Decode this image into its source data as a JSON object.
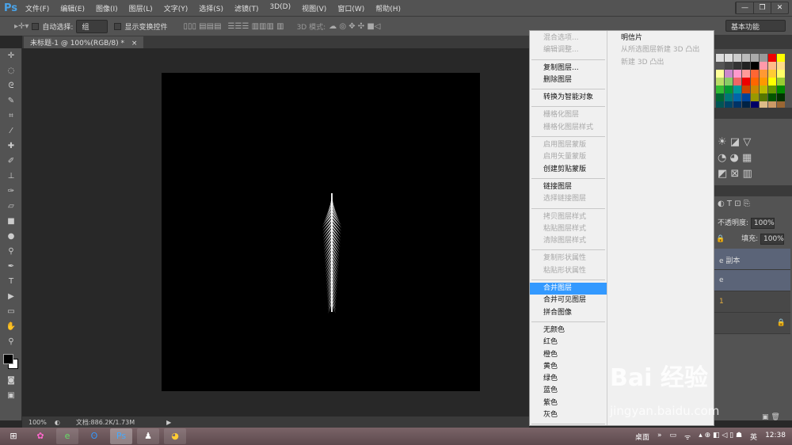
{
  "app": {
    "logo": "Ps",
    "menus": [
      "文件(F)",
      "编辑(E)",
      "图像(I)",
      "图层(L)",
      "文字(Y)",
      "选择(S)",
      "滤镜(T)",
      "3D(D)",
      "视图(V)",
      "窗口(W)",
      "帮助(H)"
    ],
    "window_controls": [
      "—",
      "❐",
      "✕"
    ]
  },
  "options": {
    "auto_select_label": "自动选择:",
    "auto_select_value": "组",
    "show_transform_label": "显示变换控件",
    "mode_3d_label": "3D 模式:",
    "workspace": "基本功能"
  },
  "document": {
    "tab_title": "未标题-1 @ 100%(RGB/8) *",
    "tab_close": "×"
  },
  "status": {
    "zoom": "100%",
    "doc_size": "文档:886.2K/1.73M"
  },
  "context_menu": {
    "left_groups": [
      [
        {
          "label": "混合选项...",
          "enabled": false
        },
        {
          "label": "编辑调整...",
          "enabled": false
        }
      ],
      [
        {
          "label": "复制图层...",
          "enabled": true
        },
        {
          "label": "删除图层",
          "enabled": true
        }
      ],
      [
        {
          "label": "转换为智能对象",
          "enabled": true
        }
      ],
      [
        {
          "label": "栅格化图层",
          "enabled": false
        },
        {
          "label": "栅格化图层样式",
          "enabled": false
        }
      ],
      [
        {
          "label": "启用图层蒙版",
          "enabled": false
        },
        {
          "label": "启用矢量蒙版",
          "enabled": false
        },
        {
          "label": "创建剪贴蒙版",
          "enabled": true
        }
      ],
      [
        {
          "label": "链接图层",
          "enabled": true
        },
        {
          "label": "选择链接图层",
          "enabled": false
        }
      ],
      [
        {
          "label": "拷贝图层样式",
          "enabled": false
        },
        {
          "label": "粘贴图层样式",
          "enabled": false
        },
        {
          "label": "清除图层样式",
          "enabled": false
        }
      ],
      [
        {
          "label": "复制形状属性",
          "enabled": false
        },
        {
          "label": "粘贴形状属性",
          "enabled": false
        }
      ],
      [
        {
          "label": "合并图层",
          "enabled": true,
          "highlighted": true
        },
        {
          "label": "合并可见图层",
          "enabled": true
        },
        {
          "label": "拼合图像",
          "enabled": true
        }
      ],
      [
        {
          "label": "无颜色",
          "enabled": true
        },
        {
          "label": "红色",
          "enabled": true
        },
        {
          "label": "橙色",
          "enabled": true
        },
        {
          "label": "黄色",
          "enabled": true
        },
        {
          "label": "绿色",
          "enabled": true
        },
        {
          "label": "蓝色",
          "enabled": true
        },
        {
          "label": "紫色",
          "enabled": true
        },
        {
          "label": "灰色",
          "enabled": true
        }
      ]
    ],
    "right_items": [
      {
        "label": "明信片",
        "enabled": true
      },
      {
        "label": "从所选图层新建 3D 凸出",
        "enabled": false
      },
      {
        "label": "新建 3D 凸出",
        "enabled": false
      }
    ]
  },
  "layers_panel": {
    "opacity_label": "不透明度:",
    "opacity_value": "100%",
    "fill_label": "填充:",
    "fill_value": "100%",
    "layers": [
      "e 副本",
      "e",
      "1",
      ""
    ]
  },
  "swatches": [
    "#ddd",
    "#ddd",
    "#ccc",
    "#bbb",
    "#aaa",
    "#999",
    "#e00",
    "#ff0",
    "#555",
    "#444",
    "#333",
    "#222",
    "#000",
    "#f9a",
    "#fb8",
    "#fd8",
    "#ff9",
    "#c8c",
    "#f9c",
    "#f99",
    "#f63",
    "#f93",
    "#fc3",
    "#ff6",
    "#bd6",
    "#8c6",
    "#e66",
    "#e00",
    "#f60",
    "#f90",
    "#ff0",
    "#9c3",
    "#3b3",
    "#093",
    "#099",
    "#c40",
    "#c80",
    "#bb0",
    "#690",
    "#080",
    "#063",
    "#077",
    "#06a",
    "#049",
    "#990",
    "#570",
    "#050",
    "#030",
    "#055",
    "#046",
    "#036",
    "#024",
    "#006",
    "#db8",
    "#c96",
    "#963",
    "#741",
    "#630",
    "#059"
  ],
  "taskbar": {
    "tray_items": [
      "桌面",
      "»",
      "英",
      "12:38"
    ]
  },
  "watermark": {
    "brand": "Bai 经验",
    "url": "jingyan.baidu.com"
  }
}
